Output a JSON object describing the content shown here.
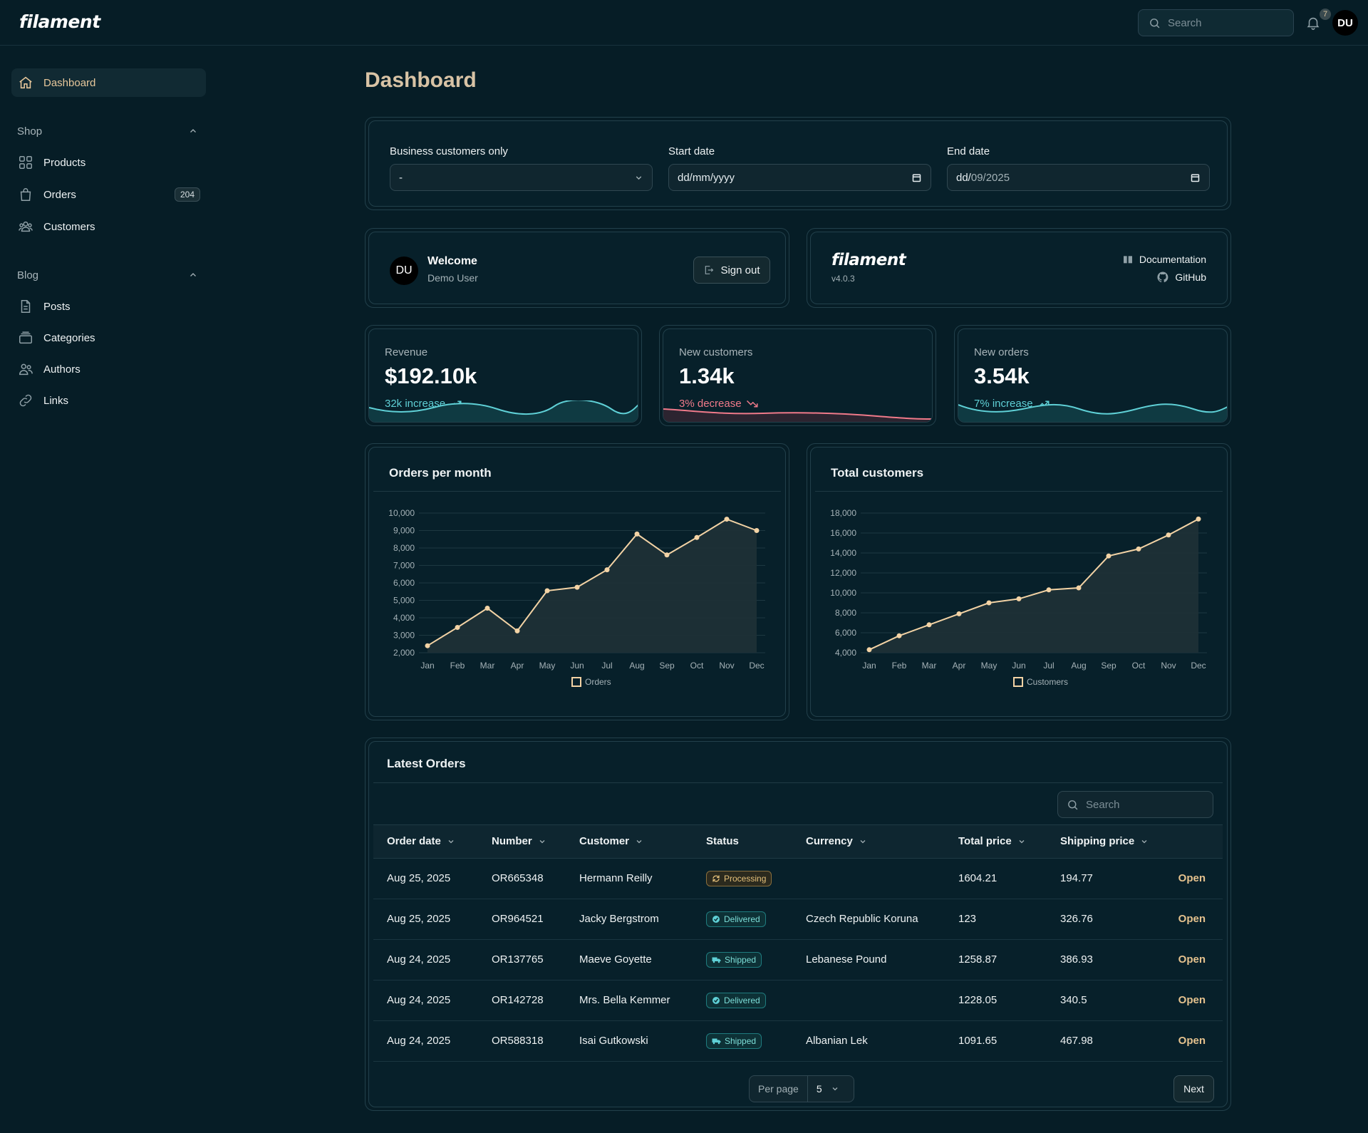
{
  "app": {
    "logo": "filament"
  },
  "topbar": {
    "search_placeholder": "Search",
    "notifications_count": "7",
    "user_initials": "DU"
  },
  "sidebar": {
    "dashboard": "Dashboard",
    "groups": [
      {
        "label": "Shop",
        "items": [
          {
            "label": "Products",
            "icon": "products-icon"
          },
          {
            "label": "Orders",
            "icon": "shopping-bag-icon",
            "badge": "204"
          },
          {
            "label": "Customers",
            "icon": "users-icon"
          }
        ]
      },
      {
        "label": "Blog",
        "items": [
          {
            "label": "Posts",
            "icon": "document-icon"
          },
          {
            "label": "Categories",
            "icon": "folder-icon"
          },
          {
            "label": "Authors",
            "icon": "users-icon"
          },
          {
            "label": "Links",
            "icon": "link-icon"
          }
        ]
      }
    ]
  },
  "page": {
    "title": "Dashboard"
  },
  "filters": {
    "business_label": "Business customers only",
    "business_value": "-",
    "start_label": "Start date",
    "start_value": "dd/mm/yyyy",
    "end_label": "End date",
    "end_value_prefix": "dd/",
    "end_value_rest": "09/2025"
  },
  "welcome": {
    "initials": "DU",
    "title": "Welcome",
    "user": "Demo User",
    "signout": "Sign out"
  },
  "info": {
    "logo": "filament",
    "version": "v4.0.3",
    "docs": "Documentation",
    "github": "GitHub"
  },
  "stats": [
    {
      "label": "Revenue",
      "value": "$192.10k",
      "trend": "32k increase",
      "direction": "up",
      "color": "#5fd0d6"
    },
    {
      "label": "New customers",
      "value": "1.34k",
      "trend": "3% decrease",
      "direction": "down",
      "color": "#f07a8a"
    },
    {
      "label": "New orders",
      "value": "3.54k",
      "trend": "7% increase",
      "direction": "up",
      "color": "#5fd0d6"
    }
  ],
  "chart_data": [
    {
      "type": "line",
      "title": "Orders per month",
      "x": [
        "Jan",
        "Feb",
        "Mar",
        "Apr",
        "May",
        "Jun",
        "Jul",
        "Aug",
        "Sep",
        "Oct",
        "Nov",
        "Dec"
      ],
      "series": [
        {
          "name": "Orders",
          "values": [
            2400,
            3450,
            4550,
            3250,
            5550,
            5750,
            6750,
            8800,
            7600,
            8600,
            9650,
            9000
          ]
        }
      ],
      "ylim": [
        2000,
        10000
      ],
      "yticks": [
        "2,000",
        "3,000",
        "4,000",
        "5,000",
        "6,000",
        "7,000",
        "8,000",
        "9,000",
        "10,000"
      ],
      "color": "#f3d3a5",
      "grid": true,
      "legend": "bottom"
    },
    {
      "type": "line",
      "title": "Total customers",
      "x": [
        "Jan",
        "Feb",
        "Mar",
        "Apr",
        "May",
        "Jun",
        "Jul",
        "Aug",
        "Sep",
        "Oct",
        "Nov",
        "Dec"
      ],
      "series": [
        {
          "name": "Customers",
          "values": [
            4300,
            5700,
            6800,
            7900,
            9000,
            9400,
            10300,
            10500,
            13700,
            14400,
            15800,
            17400
          ]
        }
      ],
      "ylim": [
        4000,
        18000
      ],
      "yticks": [
        "4,000",
        "6,000",
        "8,000",
        "10,000",
        "12,000",
        "14,000",
        "16,000",
        "18,000"
      ],
      "color": "#f3d3a5",
      "grid": true,
      "legend": "bottom"
    }
  ],
  "orders_table": {
    "title": "Latest Orders",
    "search_placeholder": "Search",
    "columns": [
      "Order date",
      "Number",
      "Customer",
      "Status",
      "Currency",
      "Total price",
      "Shipping price"
    ],
    "action": "Open",
    "rows": [
      {
        "date": "Aug 25, 2025",
        "number": "OR665348",
        "customer": "Hermann Reilly",
        "status": "Processing",
        "currency": "",
        "total": "1604.21",
        "shipping": "194.77"
      },
      {
        "date": "Aug 25, 2025",
        "number": "OR964521",
        "customer": "Jacky Bergstrom",
        "status": "Delivered",
        "currency": "Czech Republic Koruna",
        "total": "123",
        "shipping": "326.76"
      },
      {
        "date": "Aug 24, 2025",
        "number": "OR137765",
        "customer": "Maeve Goyette",
        "status": "Shipped",
        "currency": "Lebanese Pound",
        "total": "1258.87",
        "shipping": "386.93"
      },
      {
        "date": "Aug 24, 2025",
        "number": "OR142728",
        "customer": "Mrs. Bella Kemmer",
        "status": "Delivered",
        "currency": "",
        "total": "1228.05",
        "shipping": "340.5"
      },
      {
        "date": "Aug 24, 2025",
        "number": "OR588318",
        "customer": "Isai Gutkowski",
        "status": "Shipped",
        "currency": "Albanian Lek",
        "total": "1091.65",
        "shipping": "467.98"
      }
    ],
    "per_page_label": "Per page",
    "per_page_value": "5",
    "next": "Next"
  }
}
